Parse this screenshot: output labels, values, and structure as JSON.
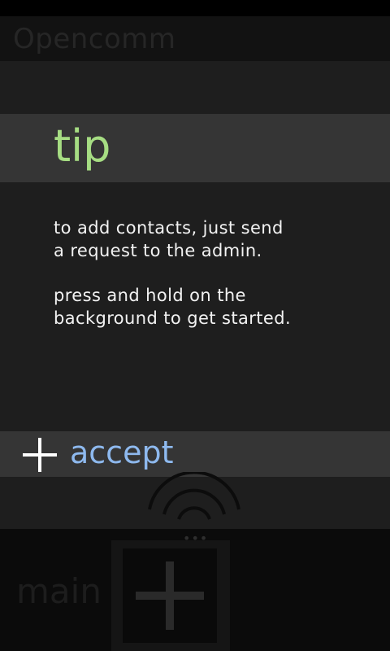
{
  "app": {
    "title": "Opencomm"
  },
  "tip": {
    "title": "tip",
    "paragraphs": [
      "to add contacts, just send\na request to the admin.",
      "press and hold on the\nbackground to get started."
    ]
  },
  "actions": {
    "accept_label": "accept"
  },
  "bottom_nav": {
    "dots": "•••",
    "main_label": "main"
  },
  "icons": {
    "accept": "plus-icon",
    "signal": "signal-icon",
    "add_tile": "plus-icon"
  },
  "colors": {
    "tip_title": "#a6dd83",
    "accept_label": "#8eb9ee",
    "background": "#1c1c1c"
  }
}
